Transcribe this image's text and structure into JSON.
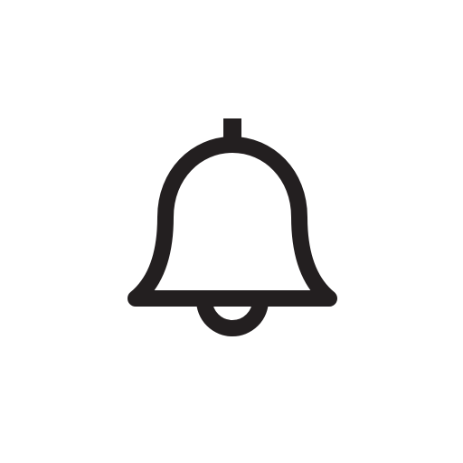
{
  "icon": {
    "name": "bell-icon",
    "color": "#231f20",
    "background": "#ffffff"
  }
}
